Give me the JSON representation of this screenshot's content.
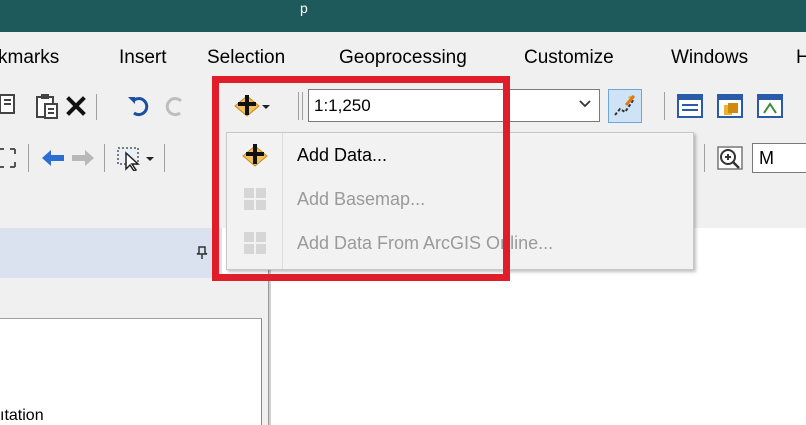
{
  "titlebar": {
    "text": "p"
  },
  "menu": {
    "items": [
      "kmarks",
      "Insert",
      "Selection",
      "Geoprocessing",
      "Customize",
      "Windows",
      "H"
    ]
  },
  "toolbar": {
    "scale_value": "1:1,250",
    "scale_dropdown_icon": "chevron-down-icon"
  },
  "toolbar2": {
    "partial_field_text": "M"
  },
  "add_data_menu": {
    "items": [
      {
        "label": "Add Data...",
        "icon": "add-data-icon",
        "enabled": true
      },
      {
        "label": "Add Basemap...",
        "icon": "basemap-grid-icon",
        "enabled": false
      },
      {
        "label": "Add Data From ArcGIS Online...",
        "icon": "arcgis-online-grid-icon",
        "enabled": false
      }
    ]
  },
  "left_panel": {
    "partial_text": "ıtation"
  },
  "colors": {
    "titlebar": "#1e5a5c",
    "highlight": "#e21d2a",
    "toolbar_bg": "#f0f0f0",
    "panel_header": "#dae2f0"
  }
}
